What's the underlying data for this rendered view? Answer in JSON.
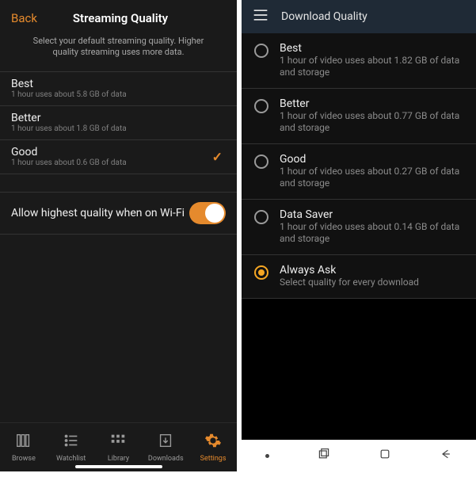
{
  "left": {
    "back": "Back",
    "title": "Streaming Quality",
    "subtitle": "Select your default streaming quality. Higher quality streaming uses more data.",
    "options": [
      {
        "name": "Best",
        "desc": "1 hour uses about 5.8 GB of data",
        "selected": false
      },
      {
        "name": "Better",
        "desc": "1 hour uses about 1.8 GB of data",
        "selected": false
      },
      {
        "name": "Good",
        "desc": "1 hour uses about 0.6 GB of data",
        "selected": true
      }
    ],
    "wifi_label": "Allow highest quality when on Wi-Fi",
    "wifi_on": true,
    "tabs": [
      {
        "label": "Browse"
      },
      {
        "label": "Watchlist"
      },
      {
        "label": "Library"
      },
      {
        "label": "Downloads"
      },
      {
        "label": "Settings"
      }
    ],
    "active_tab": 4,
    "accent": "#e58a2d"
  },
  "right": {
    "title": "Download Quality",
    "options": [
      {
        "name": "Best",
        "desc": "1 hour of video uses about 1.82 GB of data and storage",
        "selected": false
      },
      {
        "name": "Better",
        "desc": "1 hour of video uses about 0.77 GB of data and storage",
        "selected": false
      },
      {
        "name": "Good",
        "desc": "1 hour of video uses about 0.27 GB of data and storage",
        "selected": false
      },
      {
        "name": "Data Saver",
        "desc": "1 hour of video uses about 0.14 GB of data and storage",
        "selected": false
      },
      {
        "name": "Always Ask",
        "desc": "Select quality for every download",
        "selected": true
      }
    ],
    "accent": "#f5a623"
  }
}
